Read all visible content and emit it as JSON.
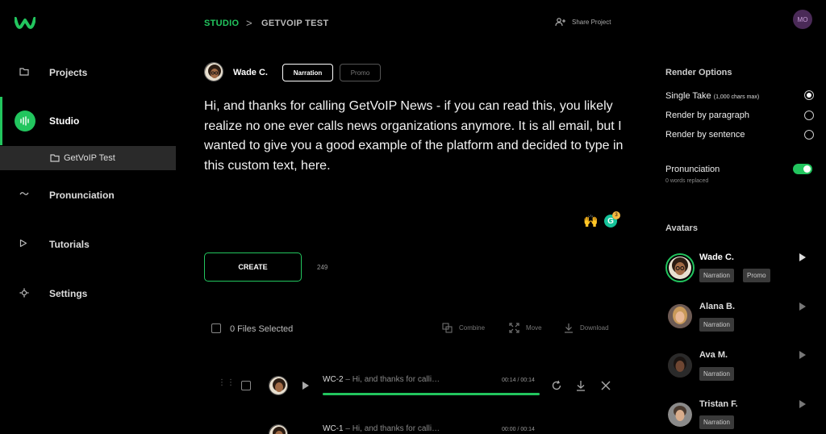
{
  "app": {
    "brand_color": "#22c55e"
  },
  "sidebar": {
    "items": [
      {
        "label": "Projects",
        "icon": "folder-icon"
      },
      {
        "label": "Studio",
        "icon": "audio-wave-icon"
      },
      {
        "label": "Pronunciation",
        "icon": "tilde-icon"
      },
      {
        "label": "Tutorials",
        "icon": "play-outline-icon"
      },
      {
        "label": "Settings",
        "icon": "gear-icon"
      }
    ],
    "sub_item": {
      "label": "GetVoIP Test",
      "icon": "folder-icon"
    }
  },
  "header": {
    "breadcrumb_studio": "STUDIO",
    "breadcrumb_sep": ">",
    "breadcrumb_project": "GETVOIP TEST",
    "share_label": "Share Project",
    "user_initials": "MO"
  },
  "editor": {
    "voice_name": "Wade C.",
    "styles": [
      "Narration",
      "Promo"
    ],
    "selected_style": "Narration",
    "script_text": "Hi, and thanks for calling GetVoIP News - if you can read this, you likely realize no one ever calls news organizations anymore. It is all email, but I wanted to give you a good example of the platform and decided to type in this custom text, here.",
    "extension_badge": "3",
    "create_label": "CREATE",
    "char_count": "249"
  },
  "files": {
    "selected_label": "0 Files Selected",
    "combine_label": "Combine",
    "move_label": "Move",
    "download_label": "Download"
  },
  "takes": [
    {
      "id": "WC-2",
      "text": "Hi, and thanks for calli…",
      "time": "00:14 / 00:14",
      "progress": 1.0
    },
    {
      "id": "WC-1",
      "text": "Hi, and thanks for calli…",
      "time": "00:00 / 00:14",
      "progress": 0.0
    }
  ],
  "render_options": {
    "heading": "Render Options",
    "options": [
      {
        "label": "Single Take",
        "note": "(1,000 chars max)",
        "selected": true
      },
      {
        "label": "Render by paragraph",
        "note": "",
        "selected": false
      },
      {
        "label": "Render by sentence",
        "note": "",
        "selected": false
      }
    ],
    "pronunciation_label": "Pronunciation",
    "pronunciation_on": true,
    "pronunciation_sub": "0 words replaced"
  },
  "avatars": {
    "heading": "Avatars",
    "list": [
      {
        "name": "Wade C.",
        "tags": [
          "Narration",
          "Promo"
        ],
        "selected": true
      },
      {
        "name": "Alana B.",
        "tags": [
          "Narration"
        ],
        "selected": false
      },
      {
        "name": "Ava M.",
        "tags": [
          "Narration"
        ],
        "selected": false
      },
      {
        "name": "Tristan F.",
        "tags": [
          "Narration"
        ],
        "selected": false
      }
    ]
  }
}
